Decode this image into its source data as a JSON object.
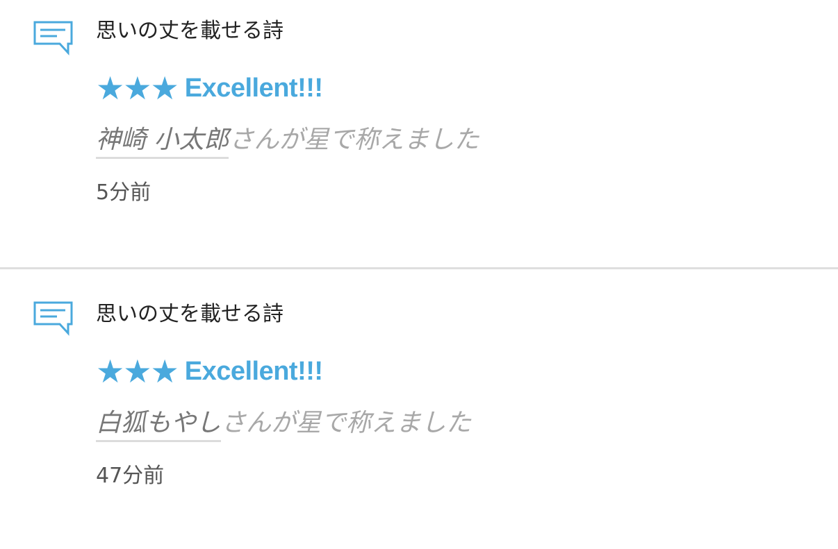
{
  "notifications": [
    {
      "icon": "comment-icon",
      "work_title": "思いの丈を載せる詩",
      "stars": "★★★",
      "rating_label": "Excellent!!!",
      "user_name": "神崎 小太郎",
      "message_suffix": "さんが星で称えました",
      "time": "5分前"
    },
    {
      "icon": "comment-icon",
      "work_title": "思いの丈を載せる詩",
      "stars": "★★★",
      "rating_label": "Excellent!!!",
      "user_name": "白狐もやし",
      "message_suffix": "さんが星で称えました",
      "time": "47分前"
    }
  ],
  "colors": {
    "accent": "#4aa9dd",
    "title_text": "#222222",
    "user_text": "#777777",
    "suffix_text": "#a8a8a8",
    "divider": "#dedede"
  }
}
